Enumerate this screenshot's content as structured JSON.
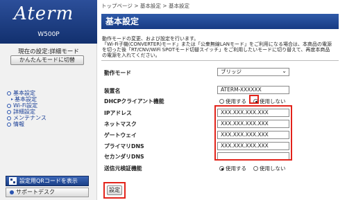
{
  "sidebar": {
    "logo": "Aterm",
    "model": "W500P",
    "current_mode": "現在の設定:詳細モード",
    "simple_mode_button": "かんたんモードに切替",
    "nav": [
      {
        "label": "基本設定"
      },
      {
        "label": "基本設定",
        "sub": true
      },
      {
        "label": "Wi-Fi設定"
      },
      {
        "label": "詳細設定"
      },
      {
        "label": "メンテナンス"
      },
      {
        "label": "情報"
      }
    ],
    "qr_button": "設定用QRコードを表示",
    "support_button": "サポートデスク"
  },
  "breadcrumb": "トップページ > 基本設定 > 基本設定",
  "page_title": "基本設定",
  "description": [
    "動作モードの変更、および設定を行います。",
    "「Wi-Fi子機(CONVERTER)モード」または「公衆無線LANモード」をご利用になる場合は、本商品の電源",
    "を切った後「RT/CNV/WiFi SPOTモード切替スイッチ」をご利用したいモードに切り替えて、再度本商品",
    "の電源を入れてください。"
  ],
  "form": {
    "operation_mode": {
      "label": "動作モード",
      "value": "ブリッジ"
    },
    "device_name": {
      "label": "装置名",
      "value": "ATERM-XXXXXX"
    },
    "dhcp_client": {
      "label": "DHCPクライアント機能",
      "options": [
        "使用する",
        "使用しない"
      ],
      "selected": 1
    },
    "ip_address": {
      "label": "IPアドレス",
      "value": "XXX.XXX.XXX.XXX"
    },
    "netmask": {
      "label": "ネットマスク",
      "value": "XXX.XXX.XXX.XXX"
    },
    "gateway": {
      "label": "ゲートウェイ",
      "value": "XXX.XXX.XXX.XXX"
    },
    "primary_dns": {
      "label": "プライマリDNS",
      "value": "XXX.XXX.XXX.XXX"
    },
    "secondary_dns": {
      "label": "セカンダリDNS",
      "value": ""
    },
    "sender_check": {
      "label": "送信元検証機能",
      "options": [
        "使用する",
        "使用しない"
      ],
      "selected": 0
    }
  },
  "set_button": "設定",
  "colors": {
    "accent": "#1b3f86",
    "highlight": "#e2231a"
  }
}
